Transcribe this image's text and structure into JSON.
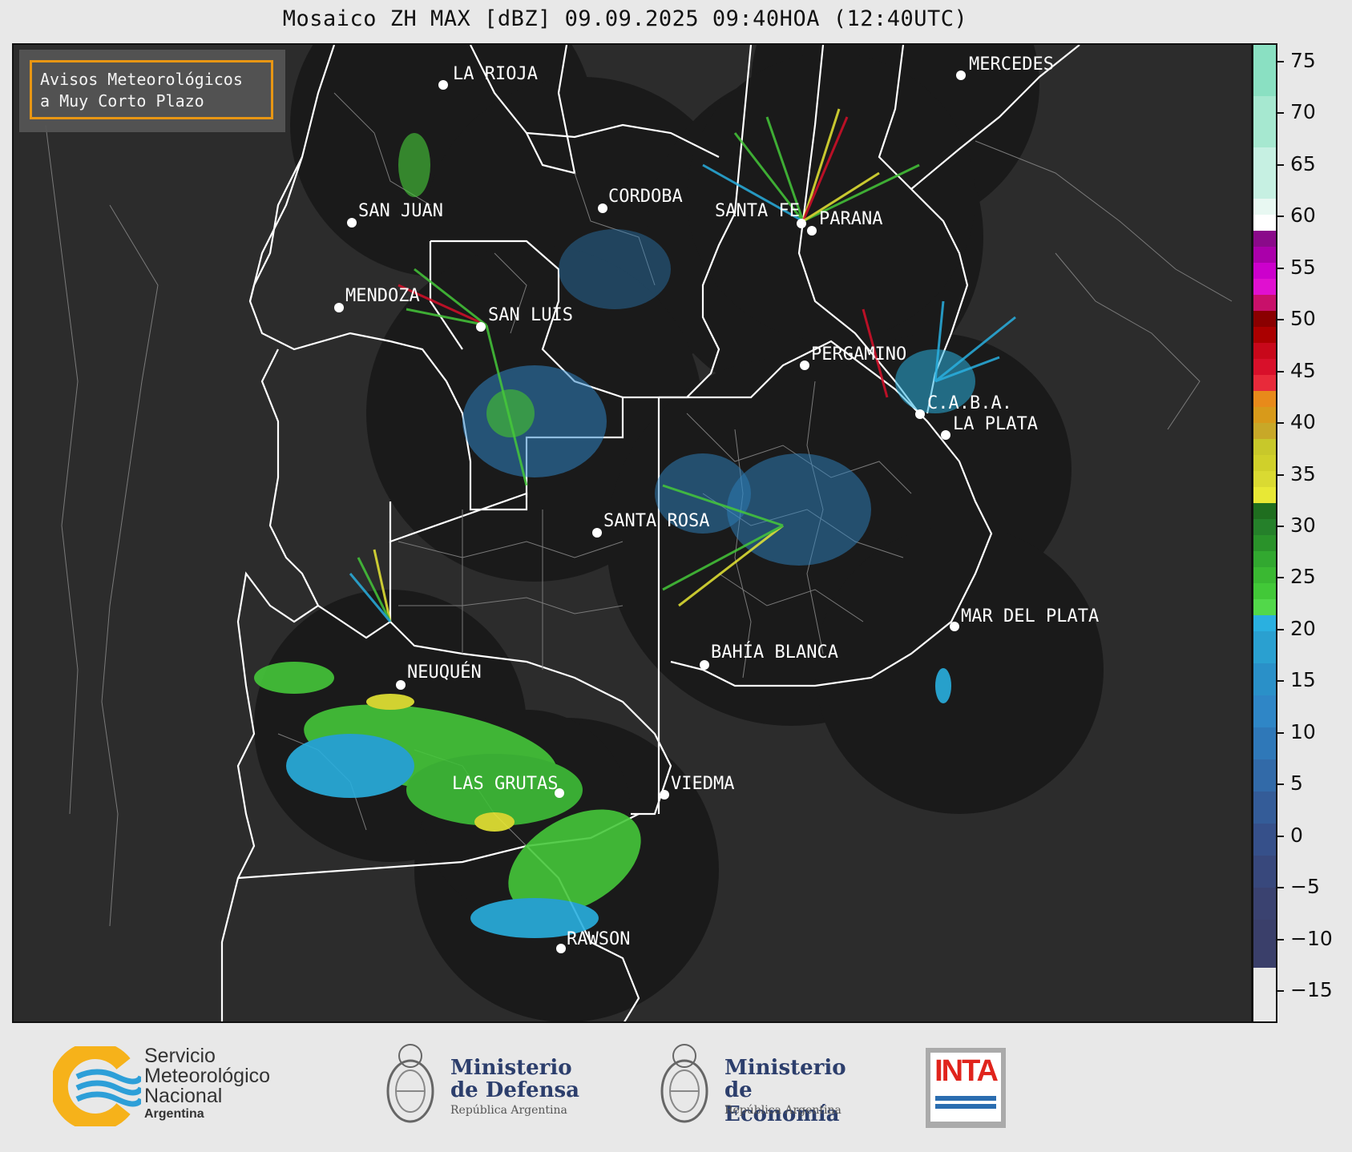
{
  "title": "Mosaico ZH MAX [dBZ] 09.09.2025 09:40HOA (12:40UTC)",
  "notice": {
    "line1": "Avisos Meteorológicos",
    "line2": "a Muy Corto Plazo"
  },
  "cities": [
    {
      "name": "LA RIOJA",
      "id": "la-rioja"
    },
    {
      "name": "MERCEDES",
      "id": "mercedes"
    },
    {
      "name": "CORDOBA",
      "id": "cordoba"
    },
    {
      "name": "SAN JUAN",
      "id": "san-juan"
    },
    {
      "name": "SANTA FE",
      "id": "santa-fe"
    },
    {
      "name": "PARANA",
      "id": "parana"
    },
    {
      "name": "MENDOZA",
      "id": "mendoza"
    },
    {
      "name": "SAN LUIS",
      "id": "san-luis"
    },
    {
      "name": "PERGAMINO",
      "id": "pergamino"
    },
    {
      "name": "C.A.B.A.",
      "id": "caba"
    },
    {
      "name": "LA PLATA",
      "id": "la-plata"
    },
    {
      "name": "SANTA ROSA",
      "id": "santa-rosa"
    },
    {
      "name": "MAR DEL PLATA",
      "id": "mar-del-plata"
    },
    {
      "name": "BAHÍA BLANCA",
      "id": "bahia-blanca"
    },
    {
      "name": "NEUQUÉN",
      "id": "neuquen"
    },
    {
      "name": "LAS GRUTAS",
      "id": "las-grutas"
    },
    {
      "name": "VIEDMA",
      "id": "viedma"
    },
    {
      "name": "RAWSON",
      "id": "rawson"
    }
  ],
  "colorbar": {
    "unit": "dBZ",
    "ticks": [
      "75",
      "70",
      "65",
      "60",
      "55",
      "50",
      "45",
      "40",
      "35",
      "30",
      "25",
      "20",
      "15",
      "10",
      "5",
      "0",
      "−5",
      "−10",
      "−15"
    ],
    "colors": {
      "low": "#3a3f6a",
      "blue": "#2f86c6",
      "cyan": "#2ab0e0",
      "green": "#46c83a",
      "darkgreen": "#1f6e1f",
      "yellow": "#e8e835",
      "orange": "#e88a1a",
      "red": "#d8102a",
      "darkred": "#8a0000",
      "magenta": "#cc00cc",
      "purple": "#8a0a8a",
      "white": "#ffffff",
      "aqua": "#7fe0c0"
    }
  },
  "logos": {
    "smn": {
      "line1": "Servicio",
      "line2": "Meteorológico",
      "line3": "Nacional",
      "line4": "Argentina"
    },
    "defensa": {
      "line1": "Ministerio",
      "line2": "de Defensa",
      "line3": "República Argentina"
    },
    "economia": {
      "line1": "Ministerio",
      "line2": "de Economía",
      "line3": "República Argentina"
    },
    "inta": {
      "text": "INTA"
    }
  }
}
